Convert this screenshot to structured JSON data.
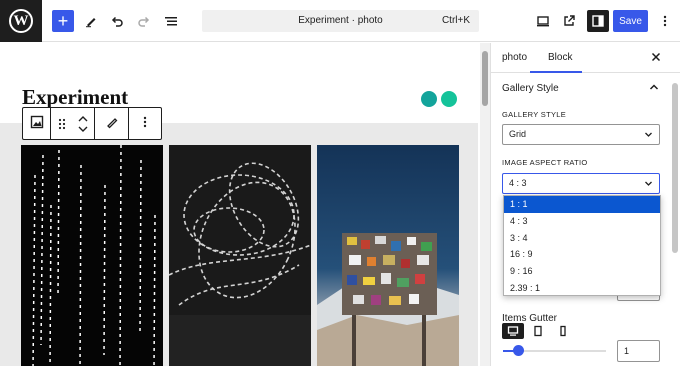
{
  "topbar": {
    "document_title": "Experiment · photo",
    "shortcut": "Ctrl+K",
    "save_label": "Save"
  },
  "canvas": {
    "heading": "Experiment"
  },
  "sidebar": {
    "tabs": [
      "photo",
      "Block"
    ],
    "panel_title": "Gallery Style",
    "gallery_style_label": "GALLERY STYLE",
    "gallery_style_value": "Grid",
    "aspect_ratio_label": "IMAGE ASPECT RATIO",
    "aspect_ratio_value": "4 : 3",
    "aspect_ratio_options": [
      "1 : 1",
      "4 : 3",
      "3 : 4",
      "16 : 9",
      "9 : 16",
      "2.39 : 1"
    ],
    "highlighted_option": "1 : 1",
    "gutter_label": "Items Gutter",
    "gutter_value": "1"
  },
  "colors": {
    "accent": "#3858e9",
    "dark": "#1e1e1e",
    "dropdown_highlight": "#0b57d0"
  },
  "icons": [
    "wordpress-logo",
    "plus-icon",
    "pen-icon",
    "undo-icon",
    "redo-icon",
    "list-view-icon",
    "desktop-icon",
    "external-link-icon",
    "sidebar-toggle-icon",
    "more-vertical-icon",
    "close-icon",
    "chevron-up-icon",
    "chevron-down-icon",
    "gallery-icon",
    "drag-handle-icon",
    "move-arrows-icon",
    "edit-icon",
    "desktop-device-icon",
    "tablet-device-icon",
    "mobile-device-icon"
  ]
}
